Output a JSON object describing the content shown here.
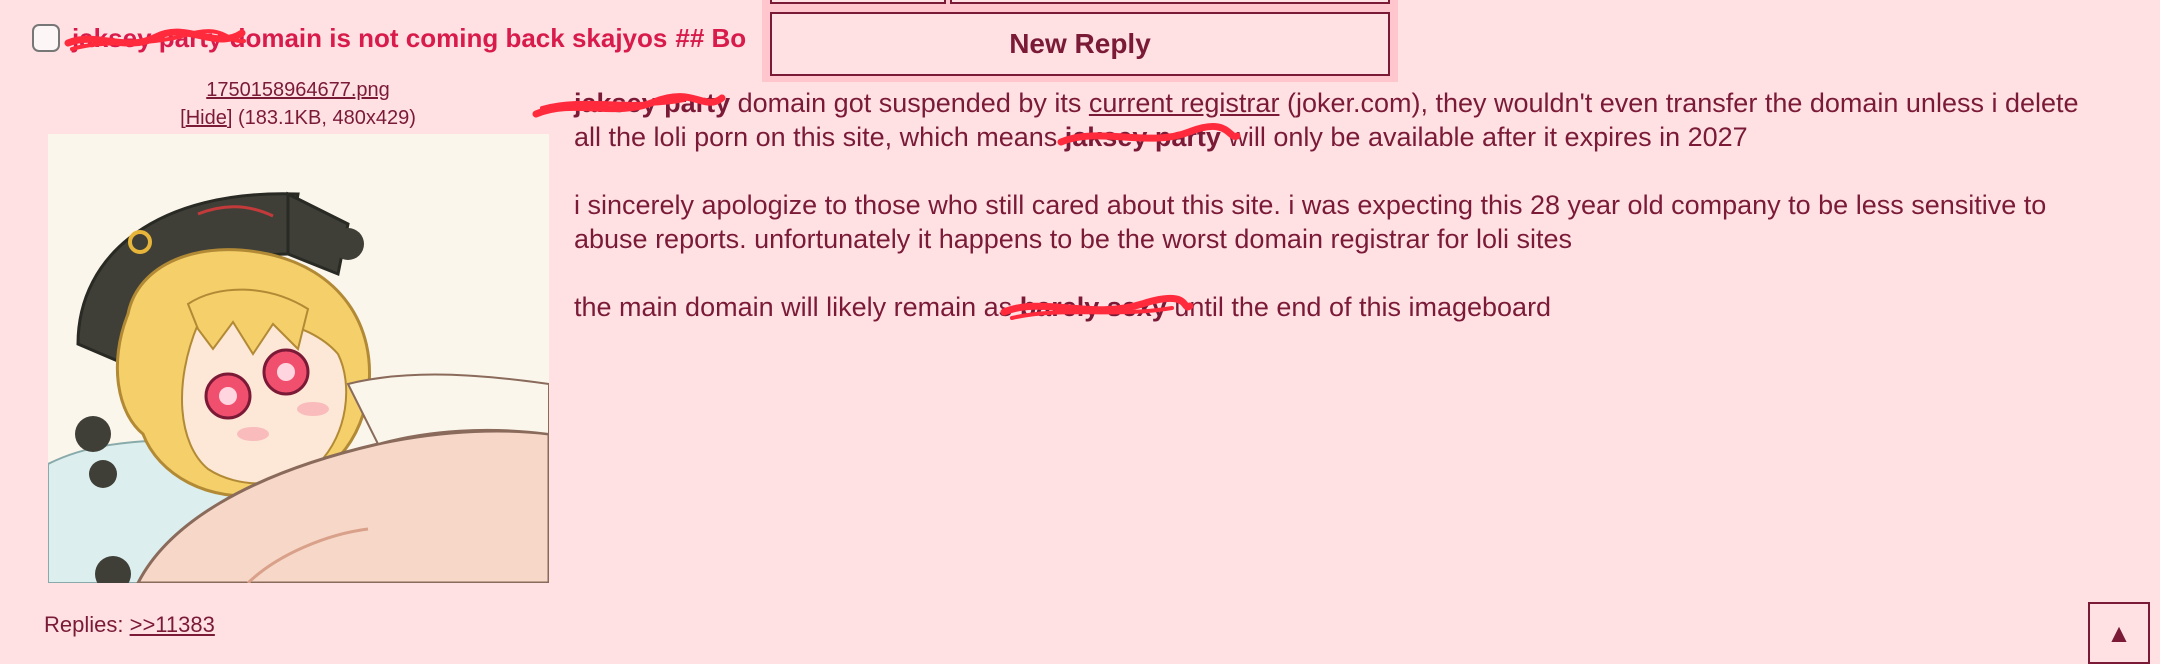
{
  "post": {
    "subject_redacted": "jaksey party",
    "subject": "domain is not coming back skajyos",
    "tripcode": "## Bo",
    "file": {
      "name": "1750158964677.png",
      "hide_label": "Hide",
      "meta": "(183.1KB, 480x429)"
    },
    "body": {
      "p1_redacted_1": "jaksey party",
      "p1_a": "domain got suspended by its",
      "p1_link": "current registrar",
      "p1_b": "(joker.com), they wouldn't even transfer the domain unless i delete all the loli porn on this site, which means",
      "p1_redacted_2": "jaksey party",
      "p1_c": "will only be available after it expires in 2027",
      "p2": "i sincerely apologize to those who still cared about this site. i was expecting this 28 year old company to be less sensitive to abuse reports. unfortunately it happens to be the worst domain registrar for loli sites",
      "p3_a": "the main domain will likely remain as",
      "p3_redacted": "barely sexy",
      "p3_b": "until the end of this imageboard"
    },
    "replies_label": "Replies:",
    "replies": [
      ">>11383"
    ]
  },
  "reply_form": {
    "button_label": "New Reply"
  },
  "scroll_top_glyph": "▲",
  "colors": {
    "background": "#ffe1e4",
    "text": "#7a1a37",
    "subject": "#d81b4a",
    "scribble": "#ff2a3c",
    "form_background": "#ffc7cd"
  }
}
